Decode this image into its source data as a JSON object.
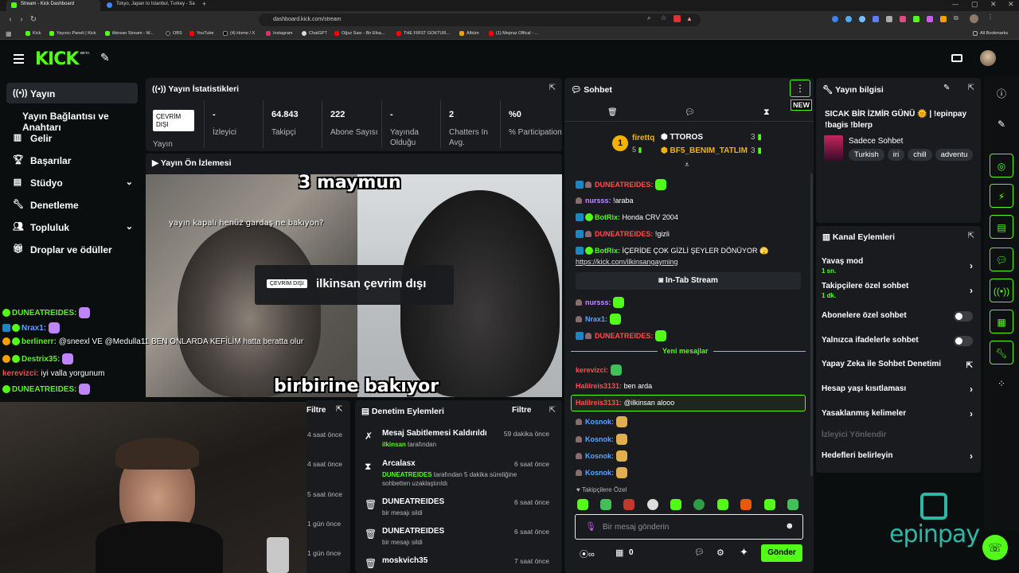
{
  "browser": {
    "tabs": [
      {
        "title": "Stream - Kick Dashboard",
        "active": true
      },
      {
        "title": "Tokyo, Japan to Istanbul, Turkey - Sa",
        "active": false
      }
    ],
    "url": "dashboard.kick.com/stream",
    "bookmarks": [
      "Kick",
      "Yayıncı Paneli | Kick",
      "ilkinsan Stream - W...",
      "OBS",
      "YouTube",
      "(4) Home / X",
      "Instagram",
      "ChatGPT",
      "Oğuz Sası - Bir Efsa...",
      "THE FIRST GOKTUR...",
      "Albüm",
      "(1) Mepraz Offical - ..."
    ],
    "all_bookmarks": "All Bookmarks"
  },
  "header": {
    "logo": "KICK",
    "beta": "BETA"
  },
  "sidebar": {
    "items": [
      {
        "label": "Yayın",
        "icon": "broadcast-icon"
      },
      {
        "label": "Yayın Bağlantısı ve Anahtarı",
        "icon": ""
      },
      {
        "label": "Gelir",
        "icon": "chart-icon"
      },
      {
        "label": "Başarılar",
        "icon": "trophy-icon"
      },
      {
        "label": "Stüdyo",
        "icon": "film-icon"
      },
      {
        "label": "Denetleme",
        "icon": "wrench-icon"
      },
      {
        "label": "Topluluk",
        "icon": "people-icon"
      },
      {
        "label": "Droplar ve ödüller",
        "icon": "gift-icon"
      }
    ]
  },
  "stats": {
    "title": "Yayın İstatistikleri",
    "status_badge": "ÇEVRİM DIŞI",
    "status_label": "Yayın",
    "items": [
      {
        "value": "-",
        "label": "İzleyici"
      },
      {
        "value": "64.843",
        "label": "Takipçi"
      },
      {
        "value": "222",
        "label": "Abone Sayısı"
      },
      {
        "value": "-",
        "label": "Yayında Olduğu"
      },
      {
        "value": "2",
        "label": "Chatters In Avg."
      },
      {
        "value": "%0",
        "label": "% Participation"
      }
    ]
  },
  "preview": {
    "title": "Yayın Ön İzlemesi",
    "meme_top": "3 maymun",
    "meme_mid": "yayın kapalı henüz gardaş ne bakıyon?",
    "meme_bottom": "birbirine bakıyor",
    "offline_badge": "ÇEVRİM DIŞI",
    "offline_text": "ilkinsan çevrim dışı"
  },
  "overlay_chat": [
    {
      "user": "DUNEATREIDES:",
      "msg": ""
    },
    {
      "user": "Nrax1:",
      "msg": ""
    },
    {
      "user": "berlinerr:",
      "msg": "@sneexl VE @Medulla11 BEN ONLARDA KEFİLİM hatta beratta olur"
    },
    {
      "user": "Destrix35:",
      "msg": ""
    },
    {
      "user": "kerevizci:",
      "msg": "iyi valla yorgunum"
    },
    {
      "user": "DUNEATREIDES:",
      "msg": ""
    }
  ],
  "left_list": {
    "filter": "Filtre",
    "times": [
      "4 saat önce",
      "4 saat önce",
      "5 saat önce",
      "1 gün önce",
      "1 gün önce"
    ]
  },
  "moderation": {
    "title": "Denetim Eylemleri",
    "filter": "Filtre",
    "items": [
      {
        "title": "Mesaj Sabitlemesi Kaldırıldı",
        "sub_user": "ilkinsan",
        "sub": "tarafından",
        "ago": "59 dakika önce",
        "icon": "unpin-icon"
      },
      {
        "title": "Arcalasx",
        "sub_user": "DUNEATREIDES",
        "sub": "tarafından 5 dakika süreliğine sohbetten uzaklaştırıldı",
        "ago": "6 saat önce",
        "icon": "hourglass-icon"
      },
      {
        "title": "DUNEATREIDES",
        "sub_user": "",
        "sub": "bir mesajı sildi",
        "ago": "6 saat önce",
        "icon": "trash-icon"
      },
      {
        "title": "DUNEATREIDES",
        "sub_user": "",
        "sub": "bir mesajı sildi",
        "ago": "6 saat önce",
        "icon": "trash-icon"
      },
      {
        "title": "moskvich35",
        "sub_user": "",
        "sub": "",
        "ago": "7 saat önce",
        "icon": "trash-icon"
      }
    ]
  },
  "chat": {
    "title": "Sohbet",
    "new_badge": "NEW",
    "gifter1": {
      "name": "firettq",
      "count": "5"
    },
    "gifter2": [
      {
        "name": "TTOROS",
        "count": "3"
      },
      {
        "name": "BF5_BENIM_TATLIM",
        "count": "3"
      }
    ],
    "rank": "1",
    "messages": [
      {
        "user": "DUNEATREIDES:",
        "msg": "",
        "color": "#ff4d4d"
      },
      {
        "user": "nursss:",
        "msg": "!araba",
        "color": "#c48bff"
      },
      {
        "user": "BotRix:",
        "msg": "Honda CRV 2004",
        "color": "#53fc18"
      },
      {
        "user": "DUNEATREIDES:",
        "msg": "!gizli",
        "color": "#ff4d4d"
      },
      {
        "user": "BotRix:",
        "msg": "İÇERİDE ÇOK GİZLİ ŞEYLER DÖNÜYOR 🫣",
        "color": "#53fc18"
      },
      {
        "user": "",
        "msg": "https://kick.com/ilkinsangayming",
        "color": "#fff"
      }
    ],
    "intab": "In-Tab Stream",
    "messages2": [
      {
        "user": "nursss:",
        "msg": "",
        "color": "#c48bff"
      },
      {
        "user": "Nrax1:",
        "msg": "",
        "color": "#5aa5ff"
      },
      {
        "user": "DUNEATREIDES:",
        "msg": "",
        "color": "#ff4d4d"
      }
    ],
    "new_messages": "Yeni mesajlar",
    "messages3": [
      {
        "user": "kerevizci:",
        "msg": "",
        "color": "#ff4d4d"
      },
      {
        "user": "Halilreis3131:",
        "msg": "ben arda",
        "color": "#ff4d4d"
      },
      {
        "user": "Halilreis3131:",
        "msg": "@ilkinsan alooo",
        "color": "#ff4d4d"
      },
      {
        "user": "Kosnok:",
        "msg": "",
        "color": "#5aa5ff"
      },
      {
        "user": "Kosnok:",
        "msg": "",
        "color": "#5aa5ff"
      },
      {
        "user": "Kosnok:",
        "msg": "",
        "color": "#5aa5ff"
      },
      {
        "user": "Kosnok:",
        "msg": "",
        "color": "#5aa5ff"
      }
    ],
    "followers_only": "Takipçilere Özel",
    "placeholder": "Bir mesaj gönderin",
    "points": "0",
    "send": "Gönder"
  },
  "info": {
    "title": "Yayın bilgisi",
    "stream_title": "SICAK BİR İZMİR GÜNÜ 🌞 | !epinpay !bagis !blerp",
    "category": "Sadece Sohbet",
    "tags": [
      "Turkish",
      "iri",
      "chill",
      "adventu"
    ]
  },
  "actions": {
    "title": "Kanal Eylemleri",
    "rows": [
      {
        "label": "Yavaş mod",
        "sub": "1 sn.",
        "type": "chevron"
      },
      {
        "label": "Takipçilere özel sohbet",
        "sub": "1 dk.",
        "type": "chevron"
      },
      {
        "label": "Abonelere özel sohbet",
        "sub": "",
        "type": "toggle"
      },
      {
        "label": "Yalnızca ifadelerle sohbet",
        "sub": "",
        "type": "toggle"
      },
      {
        "label": "Yapay Zeka ile Sohbet Denetimi",
        "sub": "",
        "type": "external"
      },
      {
        "label": "Hesap yaşı kısıtlaması",
        "sub": "",
        "type": "chevron"
      },
      {
        "label": "Yasaklanmış kelimeler",
        "sub": "",
        "type": "chevron"
      },
      {
        "label": "İzleyici Yönlendir",
        "sub": "",
        "type": "disabled"
      },
      {
        "label": "Hedefleri belirleyin",
        "sub": "",
        "type": "chevron"
      }
    ]
  },
  "sponsor": {
    "brand": "epinpay"
  },
  "colors": {
    "accent": "#53fc18",
    "panel": "#191b1f",
    "bg": "#0b0e0f"
  }
}
